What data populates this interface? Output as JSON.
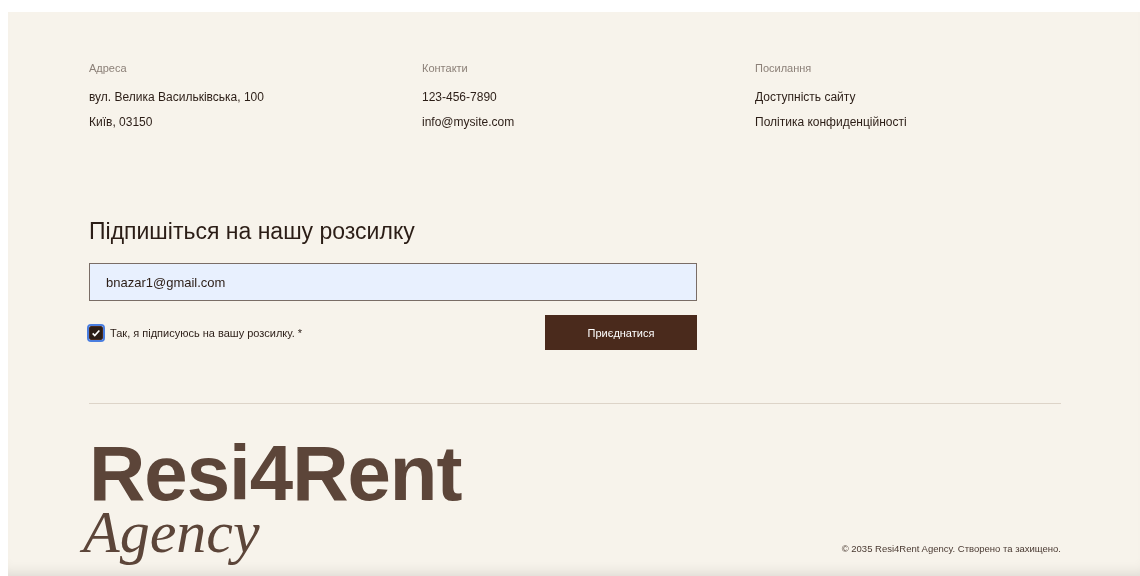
{
  "columns": [
    {
      "heading": "Адреса",
      "lines": [
        "вул. Велика Васильківська, 100",
        "Київ, 03150"
      ]
    },
    {
      "heading": "Контакти",
      "lines": [
        "123-456-7890",
        "info@mysite.com"
      ]
    },
    {
      "heading": "Посилання",
      "lines": [
        "Доступність сайту",
        "Політика конфиденційності"
      ]
    }
  ],
  "newsletter": {
    "title": "Підпишіться на нашу розсилку",
    "email": "bnazar1@gmail.com",
    "consent": {
      "label": "Так, я підписуюсь на вашу розсилку. *",
      "checked": true
    },
    "button": "Приєднатися"
  },
  "logo": {
    "name": "Resi4Rent",
    "tagline": "Agency"
  },
  "copyright": "© 2035 Resi4Rent Agency. Створено та захищено."
}
